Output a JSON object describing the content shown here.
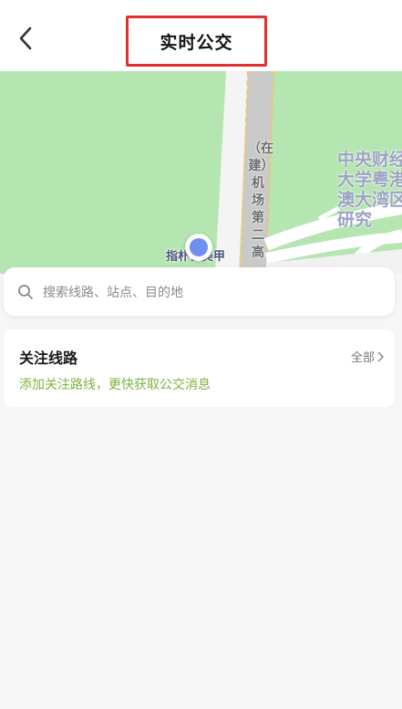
{
  "header": {
    "title": "实时公交",
    "back_icon": "chevron-left-icon"
  },
  "map": {
    "road_label": "（在建）机场第二高",
    "poi_label": "中央财经大学粤港澳大湾区研究",
    "location_label": "指朴社美甲",
    "colors": {
      "land": "#b5e5b0",
      "road": "#ffffff",
      "highway": "#c8c8c8",
      "highway_edge": "#f5c46a",
      "location_dot": "#6f8ff0"
    }
  },
  "search": {
    "placeholder": "搜索线路、站点、目的地",
    "icon": "search-icon"
  },
  "follow": {
    "title": "关注线路",
    "all_label": "全部",
    "hint": "添加关注路线，更快获取公交消息",
    "hint_color": "#7cb342"
  }
}
